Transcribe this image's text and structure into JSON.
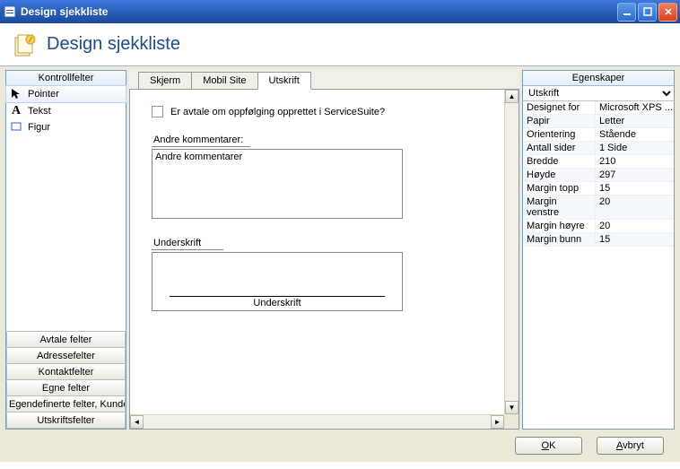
{
  "window": {
    "title": "Design sjekkliste"
  },
  "header": {
    "title": "Design sjekkliste"
  },
  "left": {
    "header": "Kontrollfelter",
    "tools": [
      {
        "icon": "pointer",
        "label": "Pointer",
        "selected": true
      },
      {
        "icon": "A",
        "label": "Tekst",
        "selected": false
      },
      {
        "icon": "figure",
        "label": "Figur",
        "selected": false
      }
    ],
    "buttons": [
      "Avtale felter",
      "Adressefelter",
      "Kontaktfelter",
      "Egne felter",
      "Egendefinerte felter, Kunde",
      "Utskriftsfelter"
    ]
  },
  "center": {
    "tabs": [
      {
        "label": "Skjerm",
        "active": false
      },
      {
        "label": "Mobil Site",
        "active": false
      },
      {
        "label": "Utskrift",
        "active": true
      }
    ],
    "form": {
      "checkbox_label": "Er avtale om oppfølging opprettet i ServiceSuite?",
      "comments_label": "Andre kommentarer:",
      "comments_value": "Andre kommentarer",
      "signature_label": "Underskrift",
      "signature_caption": "Underskrift"
    }
  },
  "right": {
    "header": "Egenskaper",
    "selector": "Utskrift",
    "props": [
      {
        "k": "Designet for",
        "v": "Microsoft XPS ..."
      },
      {
        "k": "Papir",
        "v": "Letter"
      },
      {
        "k": "Orientering",
        "v": "Stående"
      },
      {
        "k": "Antall sider",
        "v": "1 Side"
      },
      {
        "k": "Bredde",
        "v": "210"
      },
      {
        "k": "Høyde",
        "v": "297"
      },
      {
        "k": "Margin topp",
        "v": "15"
      },
      {
        "k": "Margin venstre",
        "v": "20"
      },
      {
        "k": "Margin høyre",
        "v": "20"
      },
      {
        "k": "Margin bunn",
        "v": "15"
      }
    ]
  },
  "footer": {
    "ok": "OK",
    "cancel": "Avbryt"
  }
}
